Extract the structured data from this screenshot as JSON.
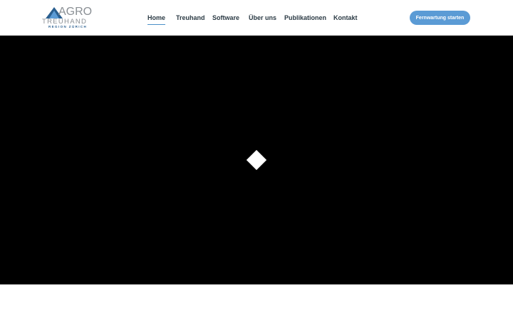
{
  "logo": {
    "word": "AGRO",
    "subtitle": "TREUHAND",
    "region": "REGION ZÜRICH",
    "colors": {
      "text": "#8a8f94",
      "triangle_dark": "#2a5f8f",
      "triangle_light": "#5b9bd5"
    }
  },
  "nav": {
    "items": [
      {
        "label": "Home",
        "active": true
      },
      {
        "label": "Treuhand",
        "active": false
      },
      {
        "label": "Software",
        "active": false
      },
      {
        "label": "Über uns",
        "active": false
      },
      {
        "label": "Publikationen",
        "active": false
      },
      {
        "label": "Kontakt",
        "active": false
      }
    ],
    "active_underline_color": "#4a90c8"
  },
  "cta": {
    "label": "Fernwartung starten",
    "color": "#5b9bd5"
  },
  "hero": {
    "background": "#000000",
    "loader_icon": "diamond-loader-icon"
  }
}
